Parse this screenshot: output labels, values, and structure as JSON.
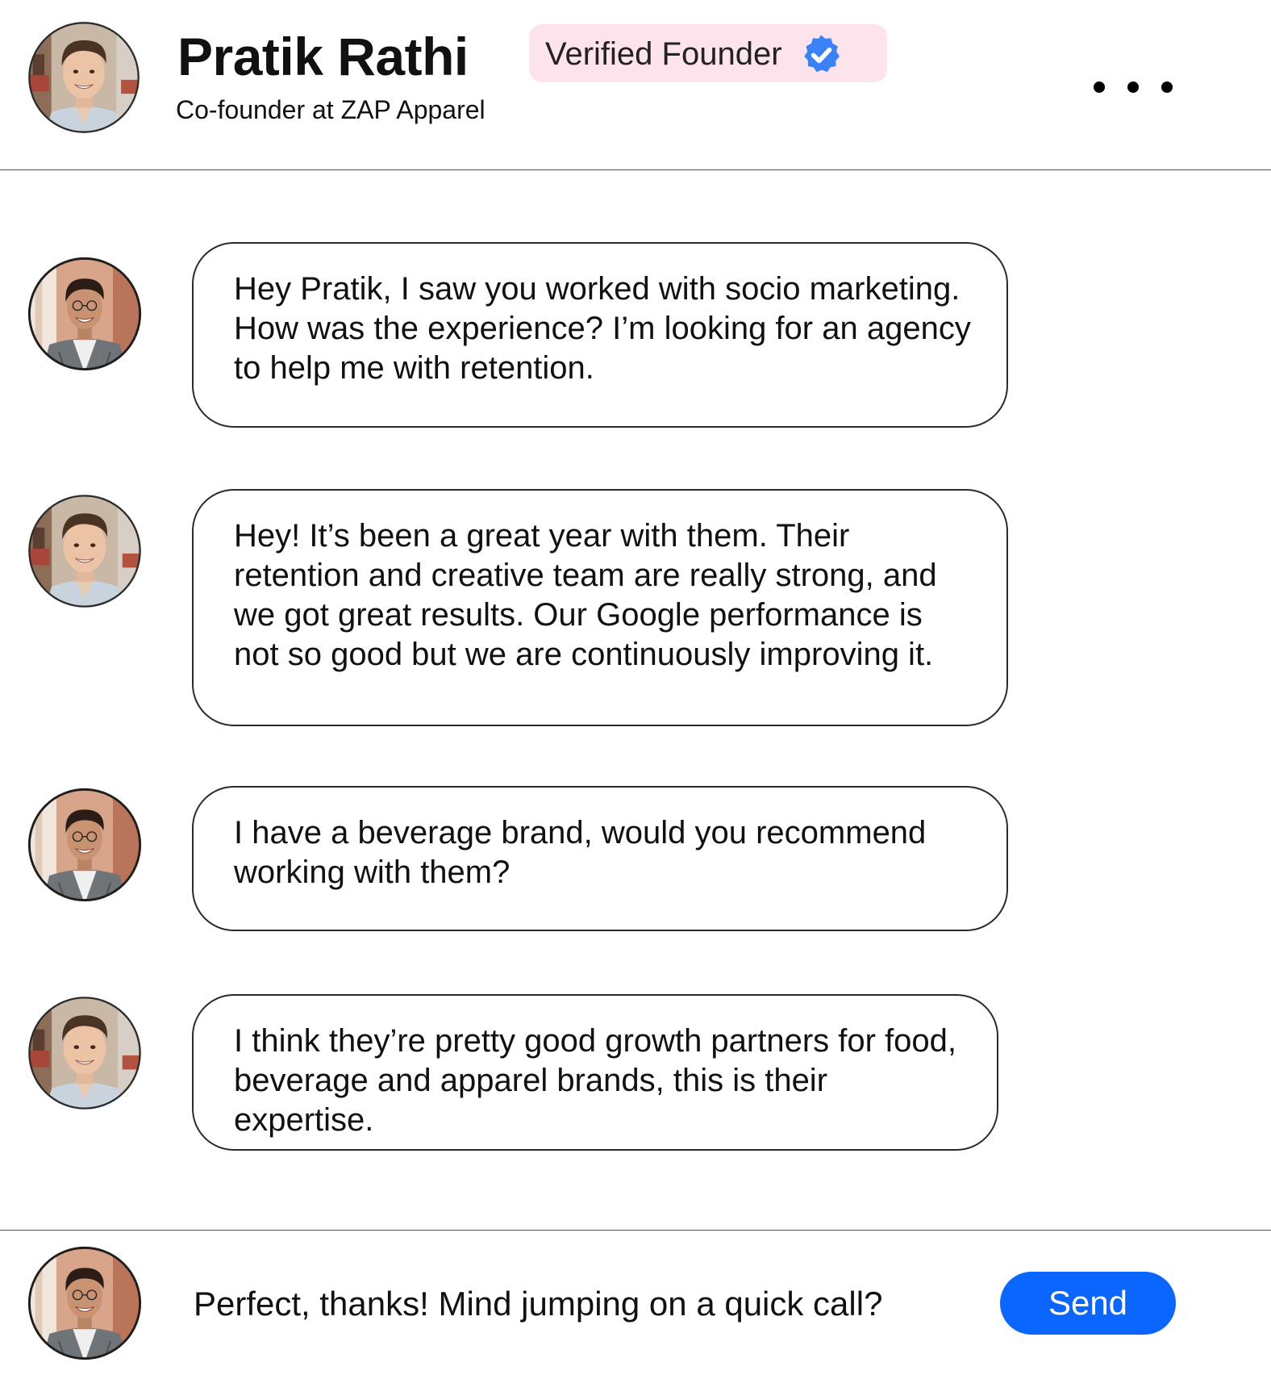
{
  "header": {
    "name": "Pratik Rathi",
    "subtitle": "Co-founder at ZAP Apparel",
    "badge_label": "Verified Founder",
    "badge_icon": "verified-check-icon",
    "more_icon": "more-dots-icon"
  },
  "messages": [
    {
      "sender": "user",
      "avatar": "user-avatar",
      "text": "Hey Pratik, I saw you worked with socio marketing. How was the experience? I’m looking for an agency to help me with retention."
    },
    {
      "sender": "founder",
      "avatar": "founder-avatar",
      "text": "Hey! It’s been a great year with them. Their retention and creative team are really strong, and we got great results. Our Google performance is not so good but we are continuously improving it."
    },
    {
      "sender": "user",
      "avatar": "user-avatar",
      "text": "I have a beverage brand, would you recommend working with them?"
    },
    {
      "sender": "founder",
      "avatar": "founder-avatar",
      "text": "I think they’re pretty good growth partners for food, beverage and apparel brands, this is their expertise."
    }
  ],
  "composer": {
    "value": "Perfect, thanks! Mind jumping on a quick call?",
    "send_label": "Send"
  },
  "colors": {
    "accent": "#0a66ff",
    "badge_background": "#fde4ec",
    "verified_icon": "#3b82f6",
    "bubble_border": "#2a2a2a"
  }
}
